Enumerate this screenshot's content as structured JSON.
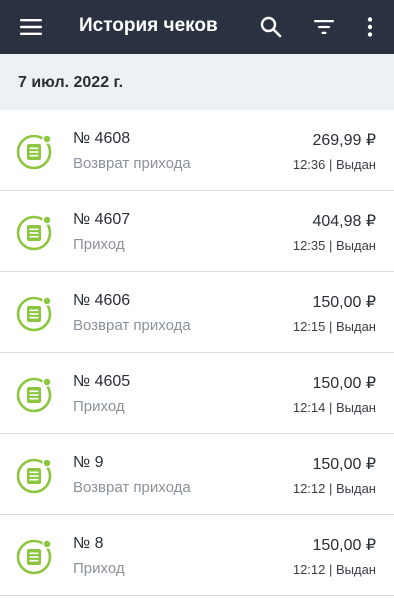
{
  "header": {
    "title": "История чеков",
    "icons": {
      "menu": "hamburger-menu-icon",
      "search": "search-icon",
      "filter": "filter-icon",
      "more": "more-vertical-icon"
    },
    "background": "#2a3140"
  },
  "date_group": {
    "label": "7 июл. 2022 г."
  },
  "receipts": [
    {
      "number": "№ 4608",
      "type": "Возврат прихода",
      "amount": "269,99 ₽",
      "meta": "12:36 | Выдан"
    },
    {
      "number": "№ 4607",
      "type": "Приход",
      "amount": "404,98 ₽",
      "meta": "12:35 | Выдан"
    },
    {
      "number": "№ 4606",
      "type": "Возврат прихода",
      "amount": "150,00 ₽",
      "meta": "12:15 | Выдан"
    },
    {
      "number": "№ 4605",
      "type": "Приход",
      "amount": "150,00 ₽",
      "meta": "12:14 | Выдан"
    },
    {
      "number": "№ 9",
      "type": "Возврат прихода",
      "amount": "150,00 ₽",
      "meta": "12:12 | Выдан"
    },
    {
      "number": "№ 8",
      "type": "Приход",
      "amount": "150,00 ₽",
      "meta": "12:12 | Выдан"
    }
  ],
  "colors": {
    "accent": "#8cc63f",
    "muted_text": "#8a929b"
  }
}
